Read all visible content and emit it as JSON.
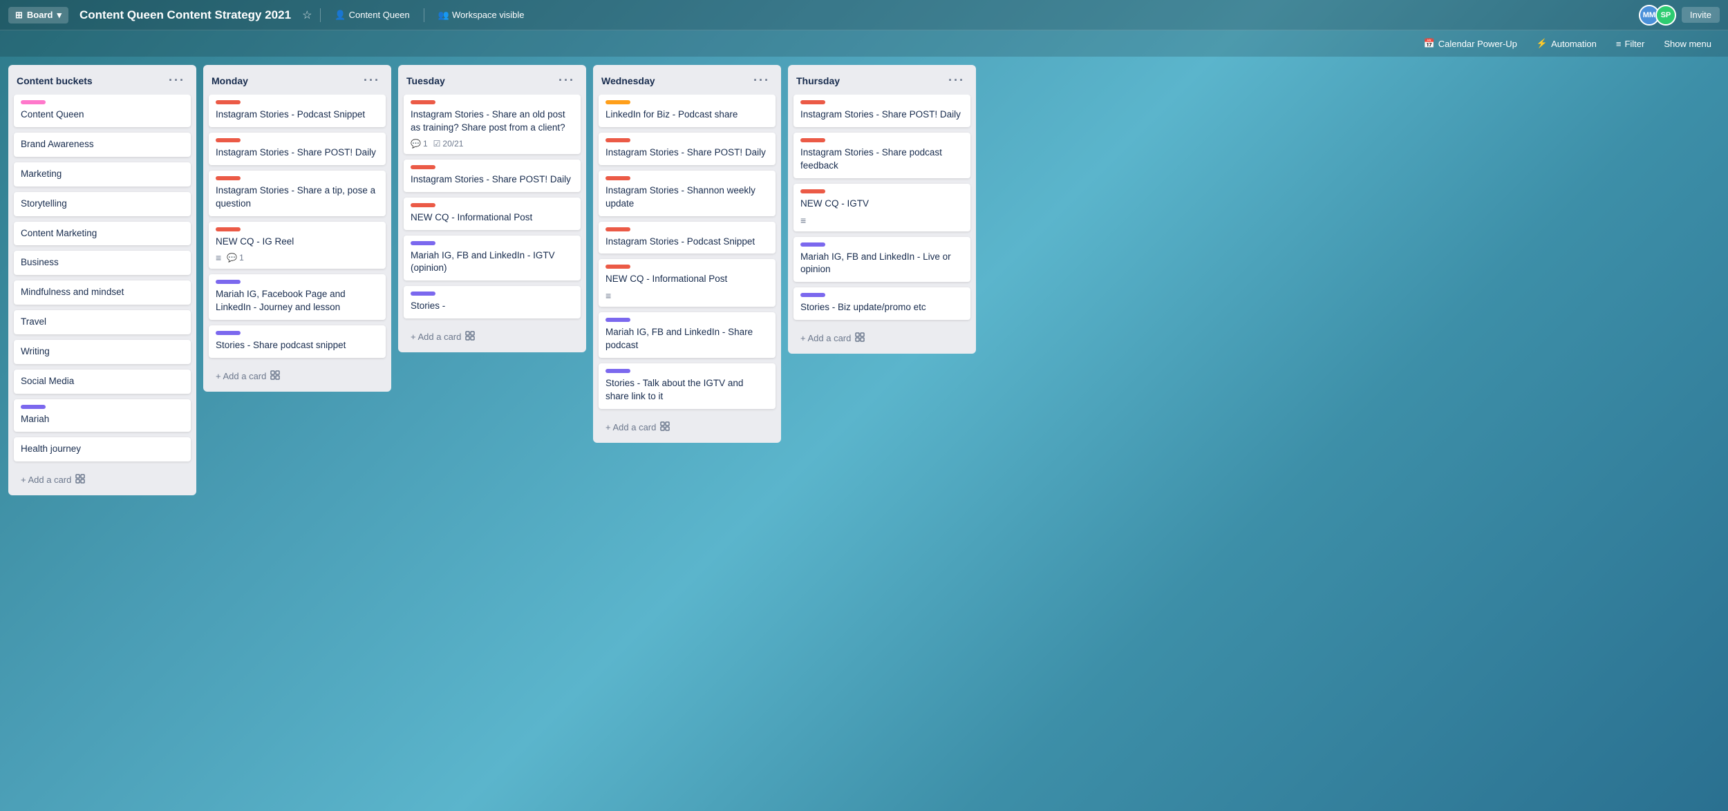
{
  "header": {
    "board_type": "Board",
    "title": "Content Queen Content Strategy 2021",
    "workspace": "Content Queen",
    "visibility": "Workspace visible",
    "invite_label": "Invite",
    "calendar_label": "Calendar Power-Up",
    "automation_label": "Automation",
    "filter_label": "Filter",
    "menu_label": "Show menu",
    "avatars": [
      {
        "initials": "MM",
        "color": "#4a90d9"
      },
      {
        "initials": "SP",
        "color": "#2ecc71"
      }
    ]
  },
  "columns": [
    {
      "id": "content-buckets",
      "title": "Content buckets",
      "cards": [
        {
          "id": "cb1",
          "label_color": "label-hot-pink",
          "title": "Content Queen",
          "meta": []
        },
        {
          "id": "cb2",
          "label_color": null,
          "title": "Brand Awareness",
          "meta": []
        },
        {
          "id": "cb3",
          "label_color": null,
          "title": "Marketing",
          "meta": []
        },
        {
          "id": "cb4",
          "label_color": null,
          "title": "Storytelling",
          "meta": []
        },
        {
          "id": "cb5",
          "label_color": null,
          "title": "Content Marketing",
          "meta": []
        },
        {
          "id": "cb6",
          "label_color": null,
          "title": "Business",
          "meta": []
        },
        {
          "id": "cb7",
          "label_color": null,
          "title": "Mindfulness and mindset",
          "meta": []
        },
        {
          "id": "cb8",
          "label_color": null,
          "title": "Travel",
          "meta": []
        },
        {
          "id": "cb9",
          "label_color": null,
          "title": "Writing",
          "meta": []
        },
        {
          "id": "cb10",
          "label_color": null,
          "title": "Social Media",
          "meta": []
        },
        {
          "id": "cb11",
          "label_color": "label-purple",
          "title": "Mariah",
          "meta": []
        },
        {
          "id": "cb12",
          "label_color": null,
          "title": "Health journey",
          "meta": []
        }
      ],
      "add_card_label": "+ Add a card"
    },
    {
      "id": "monday",
      "title": "Monday",
      "cards": [
        {
          "id": "m1",
          "label_color": "label-pink",
          "title": "Instagram Stories - Podcast Snippet",
          "meta": []
        },
        {
          "id": "m2",
          "label_color": "label-pink",
          "title": "Instagram Stories - Share POST! Daily",
          "meta": []
        },
        {
          "id": "m3",
          "label_color": "label-pink",
          "title": "Instagram Stories - Share a tip, pose a question",
          "meta": []
        },
        {
          "id": "m4",
          "label_color": "label-pink",
          "title": "NEW CQ - IG Reel",
          "meta": [
            {
              "type": "desc"
            },
            {
              "type": "comment",
              "count": "1"
            }
          ]
        },
        {
          "id": "m5",
          "label_color": "label-purple",
          "title": "Mariah IG, Facebook Page and LinkedIn - Journey and lesson",
          "meta": []
        },
        {
          "id": "m6",
          "label_color": "label-purple",
          "title": "Stories - Share podcast snippet",
          "meta": []
        }
      ],
      "add_card_label": "+ Add a card"
    },
    {
      "id": "tuesday",
      "title": "Tuesday",
      "cards": [
        {
          "id": "t1",
          "label_color": "label-pink",
          "title": "Instagram Stories - Share an old post as training? Share post from a client?",
          "meta": [
            {
              "type": "comment",
              "count": "1"
            },
            {
              "type": "checklist",
              "value": "20/21"
            }
          ]
        },
        {
          "id": "t2",
          "label_color": "label-pink",
          "title": "Instagram Stories - Share POST! Daily",
          "meta": []
        },
        {
          "id": "t3",
          "label_color": "label-pink",
          "title": "NEW CQ - Informational Post",
          "meta": []
        },
        {
          "id": "t4",
          "label_color": "label-purple",
          "title": "Mariah IG, FB and LinkedIn - IGTV (opinion)",
          "meta": []
        },
        {
          "id": "t5",
          "label_color": "label-purple",
          "title": "Stories -",
          "meta": []
        }
      ],
      "add_card_label": "+ Add a card"
    },
    {
      "id": "wednesday",
      "title": "Wednesday",
      "cards": [
        {
          "id": "w1",
          "label_color": "label-orange",
          "title": "LinkedIn for Biz - Podcast share",
          "meta": []
        },
        {
          "id": "w2",
          "label_color": "label-pink",
          "title": "Instagram Stories - Share POST! Daily",
          "meta": []
        },
        {
          "id": "w3",
          "label_color": "label-pink",
          "title": "Instagram Stories - Shannon weekly update",
          "meta": []
        },
        {
          "id": "w4",
          "label_color": "label-pink",
          "title": "Instagram Stories - Podcast Snippet",
          "meta": []
        },
        {
          "id": "w5",
          "label_color": "label-pink",
          "title": "NEW CQ - Informational Post",
          "meta": [
            {
              "type": "desc"
            }
          ]
        },
        {
          "id": "w6",
          "label_color": "label-purple",
          "title": "Mariah IG, FB and LinkedIn - Share podcast",
          "meta": []
        },
        {
          "id": "w7",
          "label_color": "label-purple",
          "title": "Stories - Talk about the IGTV and share link to it",
          "meta": []
        }
      ],
      "add_card_label": "+ Add a card"
    },
    {
      "id": "thursday",
      "title": "Thursday",
      "cards": [
        {
          "id": "th1",
          "label_color": "label-pink",
          "title": "Instagram Stories - Share POST! Daily",
          "meta": []
        },
        {
          "id": "th2",
          "label_color": "label-pink",
          "title": "Instagram Stories - Share podcast feedback",
          "meta": []
        },
        {
          "id": "th3",
          "label_color": "label-pink",
          "title": "NEW CQ - IGTV",
          "meta": [
            {
              "type": "desc"
            }
          ]
        },
        {
          "id": "th4",
          "label_color": "label-purple",
          "title": "Mariah IG, FB and LinkedIn - Live or opinion",
          "meta": []
        },
        {
          "id": "th5",
          "label_color": "label-purple",
          "title": "Stories - Biz update/promo etc",
          "meta": []
        }
      ],
      "add_card_label": "+ Add a card"
    }
  ]
}
